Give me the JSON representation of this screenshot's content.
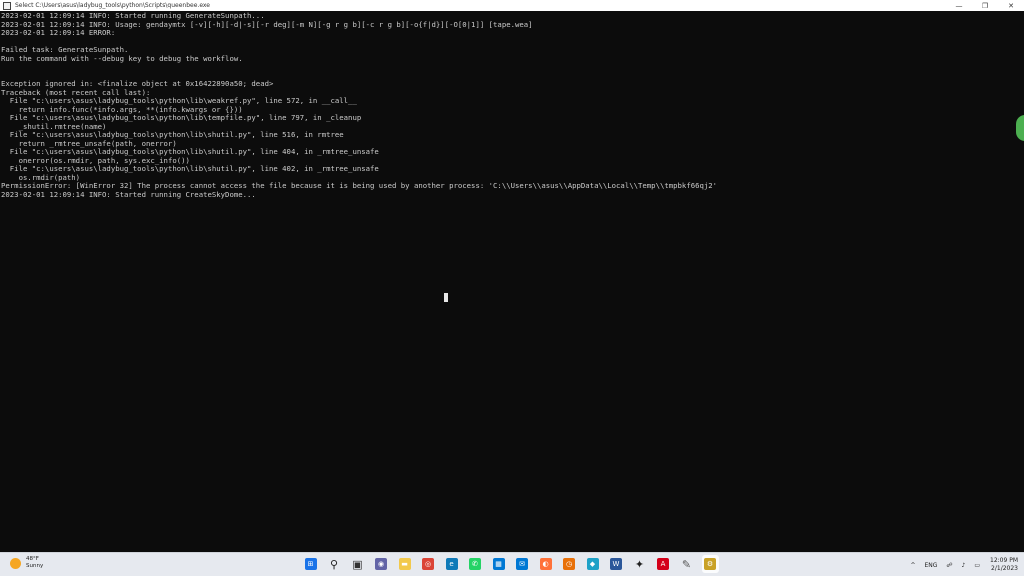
{
  "window": {
    "title": "Select C:\\Users\\asus\\ladybug_tools\\python\\Scripts\\queenbee.exe",
    "minimize": "—",
    "maximize": "❐",
    "close": "✕"
  },
  "console_lines": [
    "2023-02-01 12:09:14 INFO: Started running GenerateSunpath...",
    "2023-02-01 12:09:14 INFO: Usage: gendaymtx [-v][-h][-d|-s][-r deg][-m N][-g r g b][-c r g b][-o{f|d}][-O[0|1]] [tape.wea]",
    "2023-02-01 12:09:14 ERROR:",
    "",
    "Failed task: GenerateSunpath.",
    "Run the command with --debug key to debug the workflow.",
    "",
    "",
    "Exception ignored in: <finalize object at 0x16422890a50; dead>",
    "Traceback (most recent call last):",
    "  File \"c:\\users\\asus\\ladybug_tools\\python\\lib\\weakref.py\", line 572, in __call__",
    "    return info.func(*info.args, **(info.kwargs or {}))",
    "  File \"c:\\users\\asus\\ladybug_tools\\python\\lib\\tempfile.py\", line 797, in _cleanup",
    "    _shutil.rmtree(name)",
    "  File \"c:\\users\\asus\\ladybug_tools\\python\\lib\\shutil.py\", line 516, in rmtree",
    "    return _rmtree_unsafe(path, onerror)",
    "  File \"c:\\users\\asus\\ladybug_tools\\python\\lib\\shutil.py\", line 404, in _rmtree_unsafe",
    "    onerror(os.rmdir, path, sys.exc_info())",
    "  File \"c:\\users\\asus\\ladybug_tools\\python\\lib\\shutil.py\", line 402, in _rmtree_unsafe",
    "    os.rmdir(path)",
    "PermissionError: [WinError 32] The process cannot access the file because it is being used by another process: 'C:\\\\Users\\\\asus\\\\AppData\\\\Local\\\\Temp\\\\tmpbkf66qj2'",
    "2023-02-01 12:09:14 INFO: Started running CreateSkyDome..."
  ],
  "taskbar": {
    "weather": {
      "temp": "48°F",
      "condition": "Sunny"
    },
    "apps": [
      {
        "name": "start",
        "glyph": "⊞",
        "color": "#1a73e8"
      },
      {
        "name": "search",
        "glyph": "⚲",
        "color": "#222222"
      },
      {
        "name": "task-view",
        "glyph": "▣",
        "color": "#333333"
      },
      {
        "name": "chat",
        "glyph": "◉",
        "color": "#6264a7"
      },
      {
        "name": "file-explorer",
        "glyph": "▬",
        "color": "#f2c94c"
      },
      {
        "name": "chrome",
        "glyph": "◎",
        "color": "#db4437"
      },
      {
        "name": "edge",
        "glyph": "e",
        "color": "#0f7ab8"
      },
      {
        "name": "whatsapp",
        "glyph": "✆",
        "color": "#25d366"
      },
      {
        "name": "store",
        "glyph": "▦",
        "color": "#0078d4"
      },
      {
        "name": "mail",
        "glyph": "✉",
        "color": "#0078d4"
      },
      {
        "name": "firefox",
        "glyph": "◐",
        "color": "#ff7139"
      },
      {
        "name": "photos",
        "glyph": "◷",
        "color": "#e8710a"
      },
      {
        "name": "sketchup",
        "glyph": "◆",
        "color": "#1da1c7"
      },
      {
        "name": "word",
        "glyph": "W",
        "color": "#2b579a"
      },
      {
        "name": "inkscape",
        "glyph": "✦",
        "color": "#222222"
      },
      {
        "name": "acrobat",
        "glyph": "A",
        "color": "#d4001a"
      },
      {
        "name": "pen-tool",
        "glyph": "✎",
        "color": "#555555"
      },
      {
        "name": "queenbee-terminal",
        "glyph": "⚙",
        "color": "#c9a227"
      }
    ],
    "tray": {
      "chevron": "^",
      "language": "ENG",
      "wifi": "☍",
      "volume": "♪",
      "battery": "▭",
      "time": "12:09 PM",
      "date": "2/1/2023"
    }
  }
}
